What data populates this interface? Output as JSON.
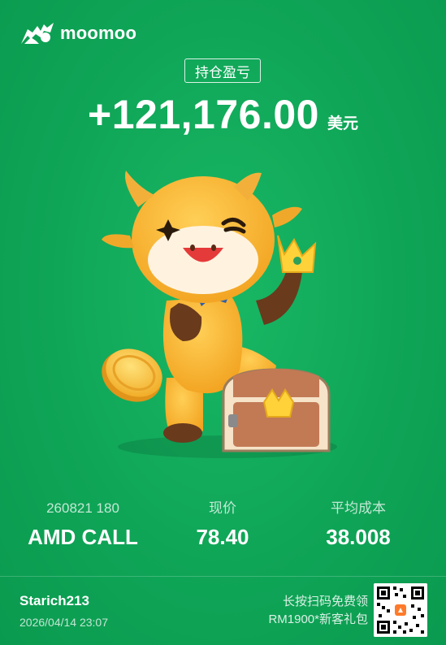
{
  "brand": {
    "name": "moomoo",
    "logo_icon": "bull-logo-icon"
  },
  "badge": "持仓盈亏",
  "pnl": {
    "value": "+121,176.00",
    "unit": "美元"
  },
  "illustration": "mascot-cow-icon",
  "stats": {
    "contract": {
      "label": "260821 180",
      "value": "AMD CALL"
    },
    "price": {
      "label": "现价",
      "value": "78.40"
    },
    "avg_cost": {
      "label": "平均成本",
      "value": "38.008"
    }
  },
  "footer": {
    "username": "Starich213",
    "timestamp": "2026/04/14 23:07",
    "promo_line1": "长按扫码免费领",
    "promo_line2": "RM1900*新客礼包"
  },
  "colors": {
    "background": "#10a557",
    "text": "#ffffff"
  }
}
